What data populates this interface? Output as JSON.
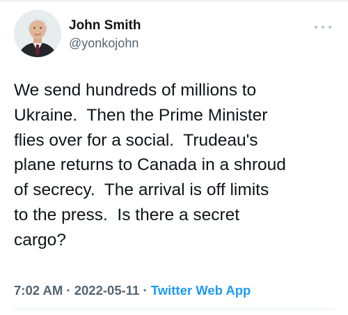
{
  "tweet": {
    "author": {
      "display_name": "John Smith",
      "handle": "@yonkojohn",
      "avatar_icon": "profile-photo"
    },
    "more_icon": "more-horizontal-icon",
    "text_lines": [
      "We send hundreds of millions to",
      "Ukraine.  Then the Prime Minister",
      "flies over for a social.  Trudeau's",
      "plane returns to Canada in a shroud",
      "of secrecy.  The arrival is off limits",
      "to the press.  Is there a secret",
      "cargo?"
    ],
    "time": "7:02 AM",
    "date": "2022-05-11",
    "separator": " · ",
    "source": "Twitter Web App"
  },
  "colors": {
    "text": "#0f1419",
    "secondary": "#536471",
    "link": "#1d9bf0"
  }
}
